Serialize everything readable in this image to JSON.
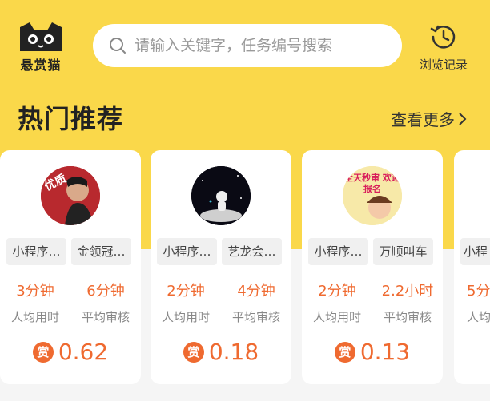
{
  "header": {
    "logo_text": "悬赏猫",
    "search_placeholder": "请输入关键字，任务编号搜索",
    "history_label": "浏览记录"
  },
  "section": {
    "title": "热门推荐",
    "more_label": "查看更多"
  },
  "cards": [
    {
      "tags": [
        "小程序…",
        "金领冠…"
      ],
      "time_value": "3分钟",
      "time_label": "人均用时",
      "review_value": "6分钟",
      "review_label": "平均审核",
      "reward_badge": "赏",
      "reward": "0.62",
      "avatar_text": "优质"
    },
    {
      "tags": [
        "小程序…",
        "艺龙会…"
      ],
      "time_value": "2分钟",
      "time_label": "人均用时",
      "review_value": "4分钟",
      "review_label": "平均审核",
      "reward_badge": "赏",
      "reward": "0.18"
    },
    {
      "tags": [
        "小程序…",
        "万顺叫车"
      ],
      "time_value": "2分钟",
      "time_label": "人均用时",
      "review_value": "2.2小时",
      "review_label": "平均审核",
      "reward_badge": "赏",
      "reward": "0.13",
      "avatar_text": "全天秒审 欢迎报名"
    },
    {
      "tags": [
        "小程"
      ],
      "time_value": "5分",
      "time_label": "人均"
    }
  ],
  "colors": {
    "brand_yellow": "#fad84a",
    "accent_orange": "#ef6a30"
  }
}
